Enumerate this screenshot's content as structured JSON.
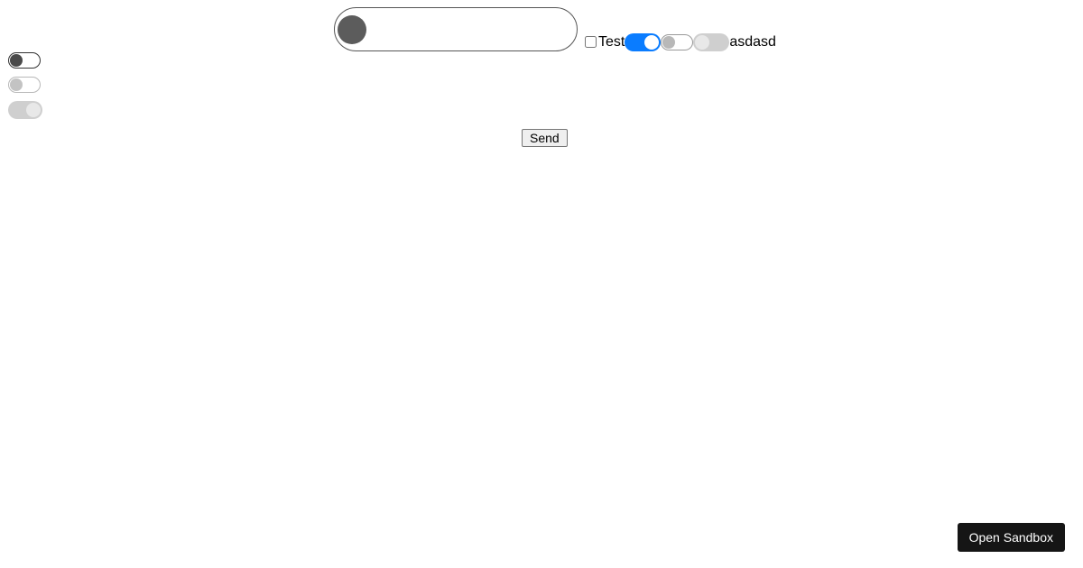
{
  "centerRow": {
    "checkboxLabel": "Test",
    "trailingText": "asdasd"
  },
  "sendButton": {
    "label": "Send"
  },
  "openSandbox": {
    "label": "Open Sandbox"
  },
  "leftToggles": {
    "toggle1": false,
    "toggle2": false,
    "toggle3": true
  },
  "centerToggles": {
    "big": false,
    "blue": true,
    "light": false,
    "disabled": false
  }
}
